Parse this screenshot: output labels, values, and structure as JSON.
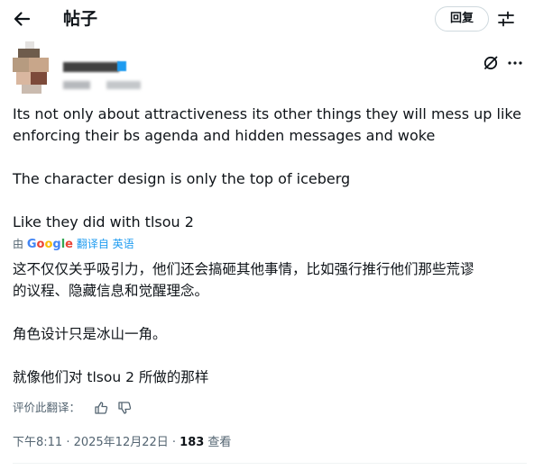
{
  "header": {
    "title": "帖子",
    "reply_label": "回复"
  },
  "post": {
    "text_en": "Its not only about attractiveness its other things they will mess up like\nenforcing their bs agenda and hidden messages and woke\n\nThe character design is only the top of iceberg\n\nLike they did with tlsou 2",
    "translation": {
      "by": "由",
      "google": [
        "G",
        "o",
        "o",
        "g",
        "l",
        "e"
      ],
      "link": "翻译自 英语"
    },
    "text_zh": "这不仅仅关乎吸引力，他们还会搞砸其他事情，比如强行推行他们那些荒谬\n的议程、隐藏信息和觉醒理念。\n\n角色设计只是冰山一角。\n\n就像他们对 tlsou 2 所做的那样",
    "rate_label": "评价此翻译：",
    "meta": {
      "time": "下午8:11 · 2025年12月22日 · ",
      "views": "183",
      "views_label": " 查看"
    }
  },
  "colors": {
    "accent": "#1d9bf0",
    "google": [
      "#4285f4",
      "#ea4335",
      "#fbbc05",
      "#4285f4",
      "#34a853",
      "#ea4335"
    ]
  },
  "icons": [
    "back-arrow-icon",
    "adjust-icon",
    "grok-icon",
    "more-icon",
    "thumbs-up-icon",
    "thumbs-down-icon"
  ]
}
